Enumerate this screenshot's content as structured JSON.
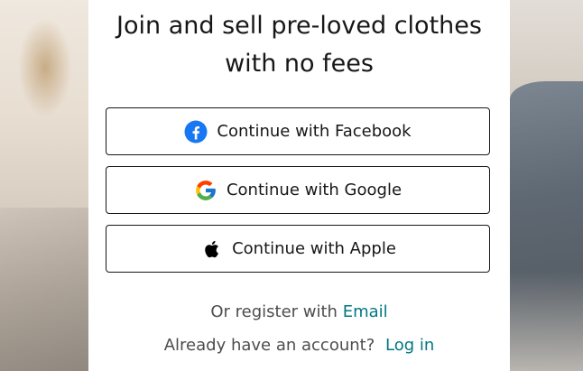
{
  "title_line1": "Join and sell pre-loved clothes",
  "title_line2": "with no fees",
  "buttons": {
    "facebook": {
      "label": "Continue with Facebook",
      "icon": "facebook-icon",
      "color": "#1877F2"
    },
    "google": {
      "label": "Continue with Google",
      "icon": "google-icon"
    },
    "apple": {
      "label": "Continue with Apple",
      "icon": "apple-icon"
    }
  },
  "register": {
    "prefix": "Or register with",
    "link": "Email"
  },
  "login": {
    "prefix": "Already have an account?",
    "link": "Log in"
  },
  "colors": {
    "link": "#007782",
    "text": "#171717",
    "muted": "#4d4d4d"
  }
}
